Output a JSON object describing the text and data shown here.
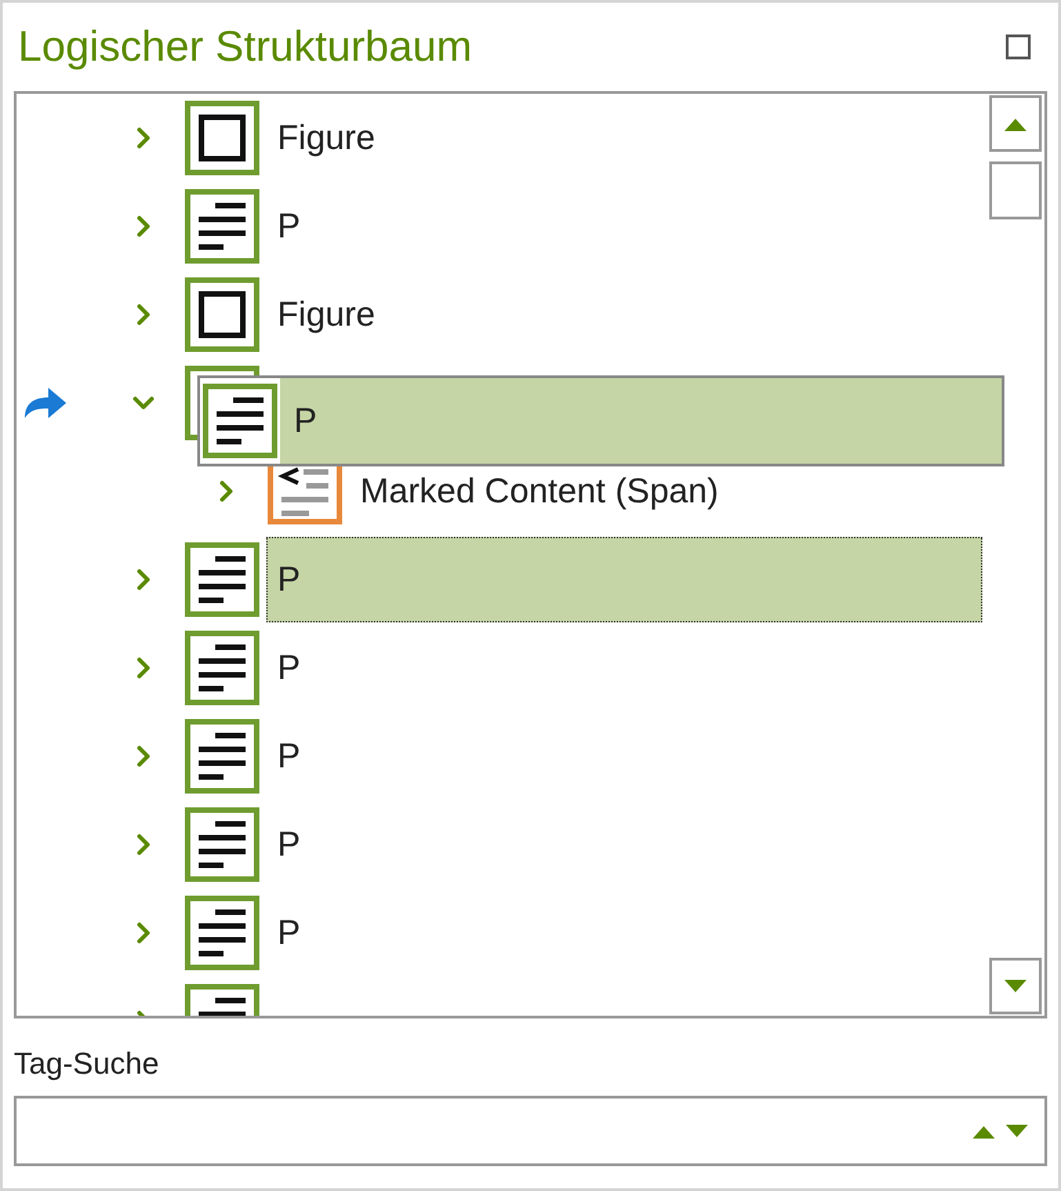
{
  "panel": {
    "title": "Logischer Strukturbaum"
  },
  "tree": {
    "nodes": [
      {
        "label": "Figure",
        "kind": "figure",
        "expanded": false,
        "selected": false
      },
      {
        "label": "P",
        "kind": "paragraph",
        "expanded": false,
        "selected": false
      },
      {
        "label": "Figure",
        "kind": "figure",
        "expanded": false,
        "selected": false
      },
      {
        "kind": "paragraph",
        "expanded": true,
        "selected": false,
        "drop_target": true,
        "children": [
          {
            "label": "Marked Content (Span)",
            "kind": "marked-content",
            "expanded": false,
            "selected": false
          }
        ]
      },
      {
        "label": "P",
        "kind": "paragraph",
        "expanded": false,
        "selected": true
      },
      {
        "label": "P",
        "kind": "paragraph",
        "expanded": false,
        "selected": false
      },
      {
        "label": "P",
        "kind": "paragraph",
        "expanded": false,
        "selected": false
      },
      {
        "label": "P",
        "kind": "paragraph",
        "expanded": false,
        "selected": false
      },
      {
        "label": "P",
        "kind": "paragraph",
        "expanded": false,
        "selected": false
      },
      {
        "kind": "paragraph",
        "expanded": false,
        "selected": false
      }
    ]
  },
  "drag_ghost": {
    "label": "P",
    "kind": "paragraph"
  },
  "search": {
    "label": "Tag-Suche"
  }
}
